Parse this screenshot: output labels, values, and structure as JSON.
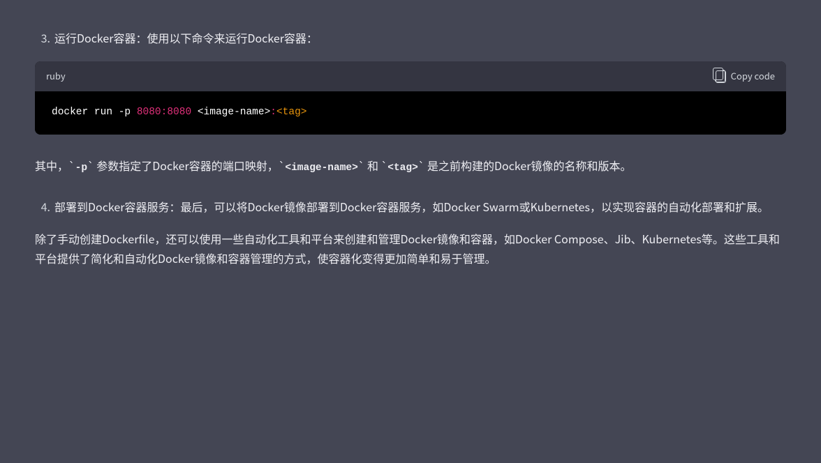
{
  "list": {
    "item3": {
      "num": "3.",
      "text": "运行Docker容器：使用以下命令来运行Docker容器："
    },
    "item4": {
      "num": "4.",
      "text": "部署到Docker容器服务：最后，可以将Docker镜像部署到Docker容器服务，如Docker Swarm或Kubernetes，以实现容器的自动化部署和扩展。"
    }
  },
  "codeblock": {
    "lang": "ruby",
    "copy_label": "Copy code",
    "code": {
      "seg1": "docker run -p ",
      "port1": "8080",
      "colon": ":",
      "port2": "8080",
      "seg2": " <image-name>",
      "colon2": ":",
      "tag": "<tag>"
    }
  },
  "para1": {
    "t1": "其中，",
    "bt": "`",
    "c1": "-p",
    "t2": " 参数指定了Docker容器的端口映射，",
    "c2": "<image-name>",
    "t3": " 和 ",
    "c3": "<tag>",
    "t4": " 是之前构建的Docker镜像的名称和版本。"
  },
  "para2": {
    "text": "除了手动创建Dockerfile，还可以使用一些自动化工具和平台来创建和管理Docker镜像和容器，如Docker Compose、Jib、Kubernetes等。这些工具和平台提供了简化和自动化Docker镜像和容器管理的方式，使容器化变得更加简单和易于管理。"
  }
}
